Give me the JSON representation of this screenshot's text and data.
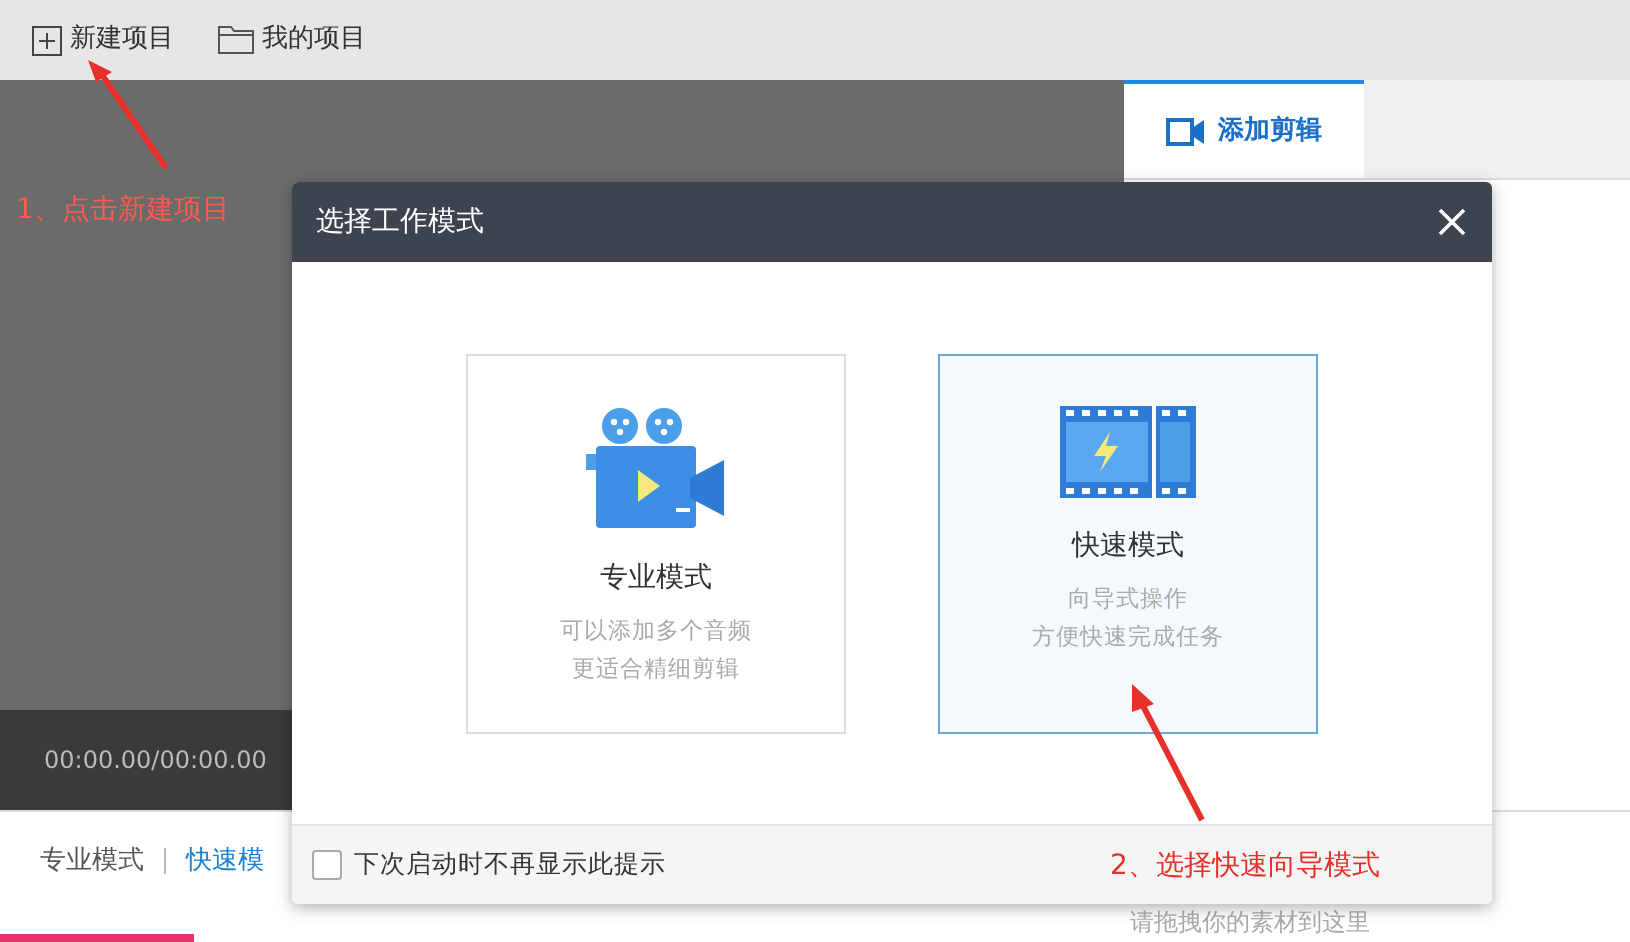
{
  "toolbar": [
    {
      "label": "新建项目",
      "kind": "new"
    },
    {
      "label": "我的项目",
      "kind": "folder"
    }
  ],
  "preview": {
    "time": "00:00.00/00:00.00"
  },
  "side_tabs": [
    {
      "label": "添加剪辑",
      "selected": true
    }
  ],
  "mode_tabs": [
    {
      "label": "专业模式",
      "selected": false
    },
    {
      "label": "快速模",
      "selected": true
    }
  ],
  "drop_hint": "请拖拽你的素材到这里",
  "dialog": {
    "title": "选择工作模式",
    "modes": [
      {
        "kind": "camera",
        "title": "专业模式",
        "lines": [
          "可以添加多个音频",
          "更适合精细剪辑"
        ],
        "selected": false
      },
      {
        "kind": "film",
        "title": "快速模式",
        "lines": [
          "向导式操作",
          "方便快速完成任务"
        ],
        "selected": true
      }
    ],
    "dont_show": {
      "label": "下次启动时不再显示此提示",
      "checked": false
    }
  },
  "annotations": [
    {
      "kind": "toolbar",
      "text": "1、点击新建项目"
    },
    {
      "kind": "mode",
      "text": "2、选择快速向导模式"
    }
  ]
}
